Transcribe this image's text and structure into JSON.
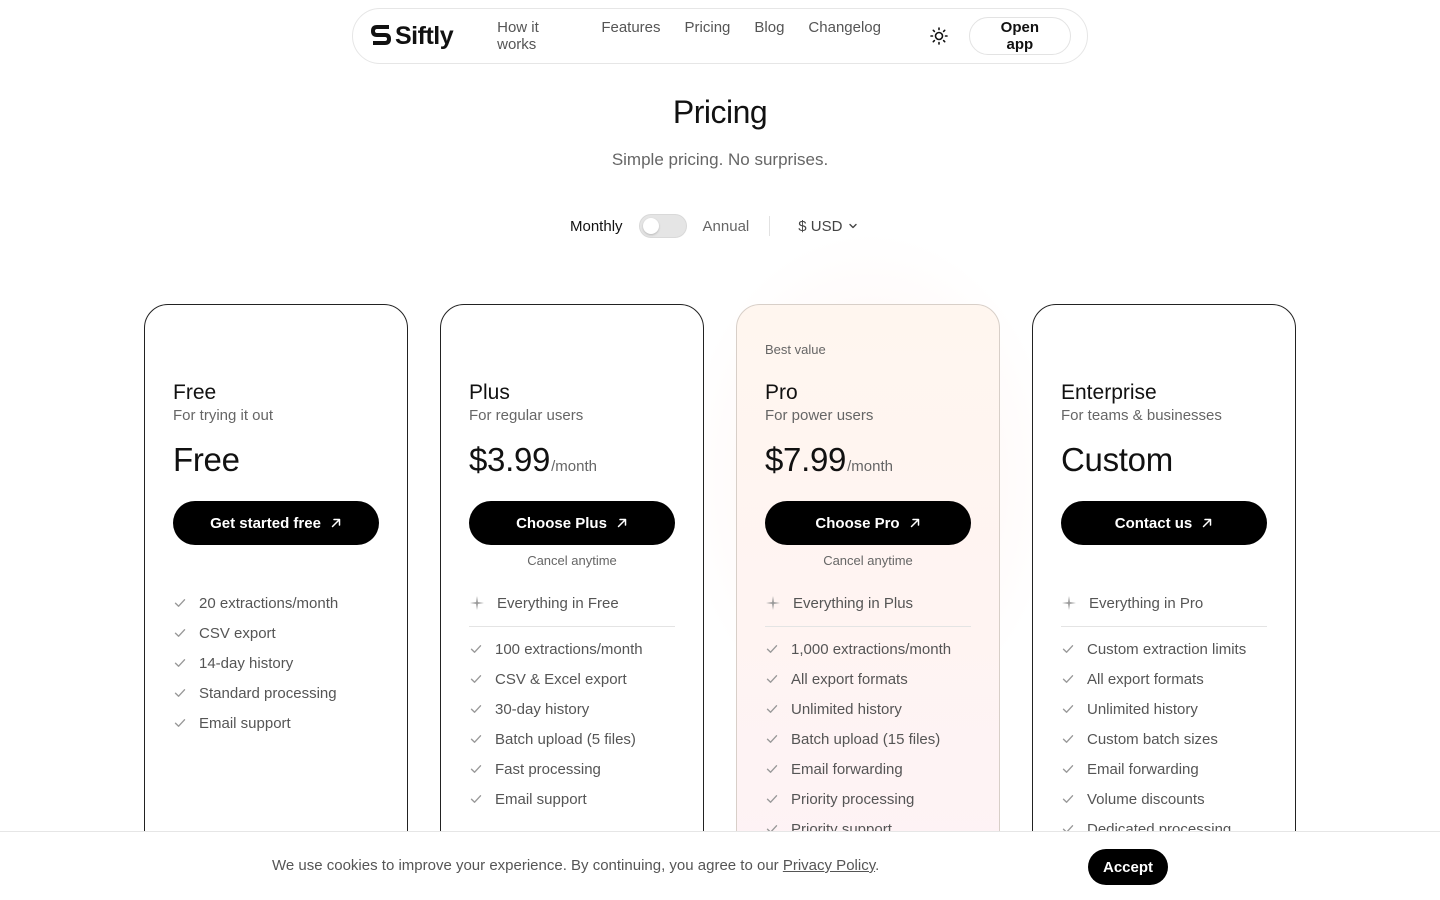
{
  "nav": {
    "logo_text": "Siftly",
    "links": [
      "How it works",
      "Features",
      "Pricing",
      "Blog",
      "Changelog"
    ],
    "theme_icon": "sun-icon",
    "open_app": "Open app"
  },
  "header": {
    "title": "Pricing",
    "subtitle": "Simple pricing. No surprises."
  },
  "billing": {
    "monthly": "Monthly",
    "annual": "Annual",
    "annual_enabled": false,
    "currency": "$ USD"
  },
  "plans": [
    {
      "badge": "",
      "name": "Free",
      "desc": "For trying it out",
      "price": "Free",
      "period": "",
      "cta": "Get started free",
      "cancel": "",
      "includes": "",
      "features": [
        "20 extractions/month",
        "CSV export",
        "14-day history",
        "Standard processing",
        "Email support"
      ]
    },
    {
      "badge": "",
      "name": "Plus",
      "desc": "For regular users",
      "price": "$3.99",
      "period": "/month",
      "cta": "Choose Plus",
      "cancel": "Cancel anytime",
      "includes": "Everything in Free",
      "features": [
        "100 extractions/month",
        "CSV & Excel export",
        "30-day history",
        "Batch upload (5 files)",
        "Fast processing",
        "Email support"
      ]
    },
    {
      "badge": "Best value",
      "name": "Pro",
      "desc": "For power users",
      "price": "$7.99",
      "period": "/month",
      "cta": "Choose Pro",
      "cancel": "Cancel anytime",
      "includes": "Everything in Plus",
      "features": [
        "1,000 extractions/month",
        "All export formats",
        "Unlimited history",
        "Batch upload (15 files)",
        "Email forwarding",
        "Priority processing",
        "Priority support"
      ]
    },
    {
      "badge": "",
      "name": "Enterprise",
      "desc": "For teams & businesses",
      "price": "Custom",
      "period": "",
      "cta": "Contact us",
      "cancel": "",
      "includes": "Everything in Pro",
      "features": [
        "Custom extraction limits",
        "All export formats",
        "Unlimited history",
        "Custom batch sizes",
        "Email forwarding",
        "Volume discounts",
        "Dedicated processing"
      ]
    }
  ],
  "cookie": {
    "text": "We use cookies to improve your experience. By continuing, you agree to our ",
    "link": "Privacy Policy",
    "period": ".",
    "accept": "Accept"
  }
}
